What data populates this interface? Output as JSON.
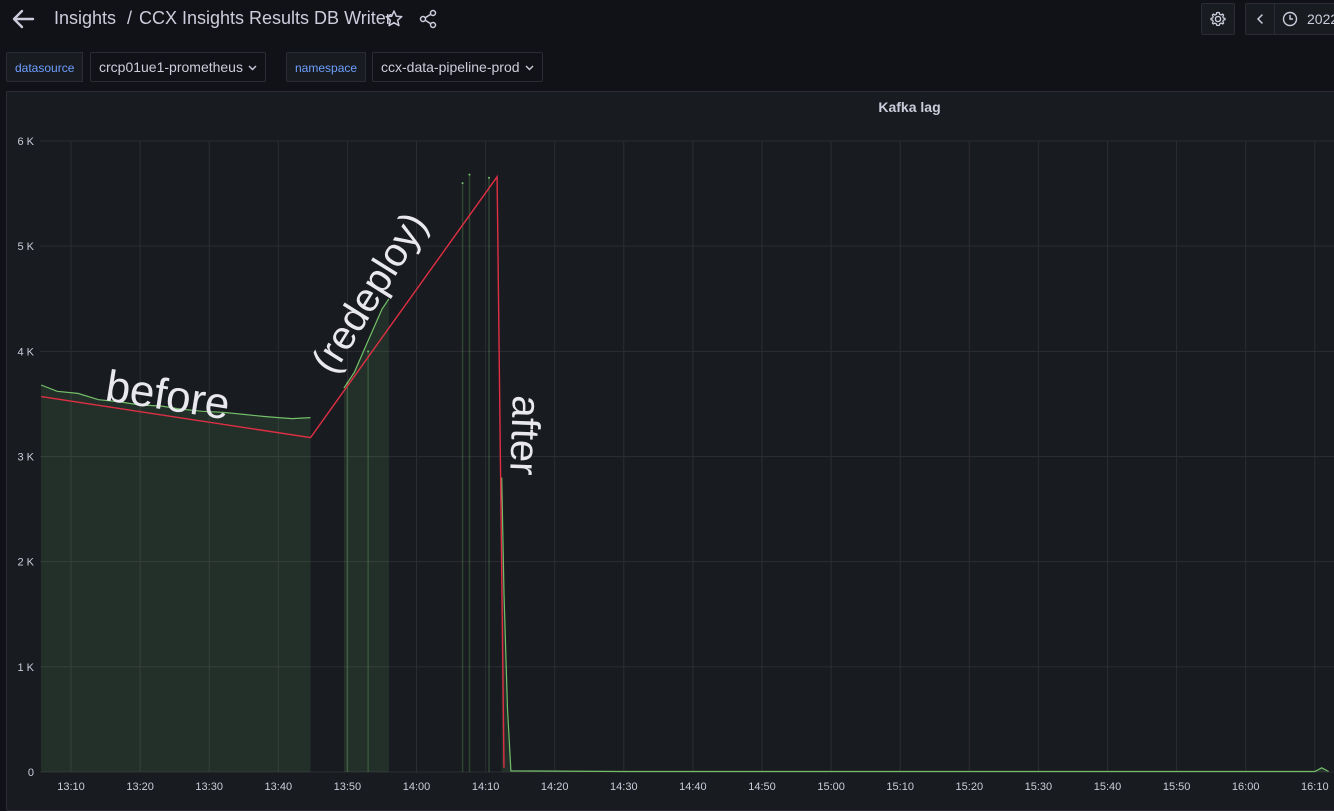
{
  "header": {
    "breadcrumb_parent": "Insights",
    "breadcrumb_separator": "/",
    "title": "CCX Insights Results DB Writer",
    "time_range_text": "2022"
  },
  "icons": {
    "back": "arrow-left-icon",
    "star": "star-icon",
    "share": "share-icon",
    "settings": "gear-icon",
    "prev": "chevron-left-icon",
    "clock": "clock-icon",
    "dropdown": "chevron-down-icon"
  },
  "variables": [
    {
      "label": "datasource",
      "value": "crcp01ue1-prometheus"
    },
    {
      "label": "namespace",
      "value": "ccx-data-pipeline-prod"
    }
  ],
  "panel": {
    "title": "Kafka lag"
  },
  "annotations": {
    "before": "before",
    "redeploy": "(redeploy)",
    "after": "after"
  },
  "colors": {
    "series_line": "#73bf69",
    "annotation_line": "#e02f44",
    "background": "#111217",
    "panel": "#181b1f"
  },
  "chart_data": {
    "type": "area",
    "title": "Kafka lag",
    "x_ticks": [
      "13:10",
      "13:20",
      "13:30",
      "13:40",
      "13:50",
      "14:00",
      "14:10",
      "14:20",
      "14:30",
      "14:40",
      "14:50",
      "15:00",
      "15:10",
      "15:20",
      "15:30",
      "15:40",
      "15:50",
      "16:00",
      "16:10"
    ],
    "y_ticks": [
      "0",
      "1 K",
      "2 K",
      "3 K",
      "4 K",
      "5 K",
      "6 K"
    ],
    "ylim": [
      0,
      6000
    ],
    "grid": true,
    "series": [
      {
        "points": [
          [
            "13:05:40",
            3680
          ],
          [
            "13:08:00",
            3620
          ],
          [
            "13:11:00",
            3600
          ],
          [
            "13:14:00",
            3540
          ],
          [
            "13:17:00",
            3520
          ],
          [
            "13:20:00",
            3490
          ],
          [
            "13:23:00",
            3480
          ],
          [
            "13:26:00",
            3450
          ],
          [
            "13:29:00",
            3430
          ],
          [
            "13:32:00",
            3420
          ],
          [
            "13:35:00",
            3400
          ],
          [
            "13:38:00",
            3380
          ],
          [
            "13:40:00",
            3370
          ],
          [
            "13:42:00",
            3360
          ],
          [
            "13:44:40",
            3370
          ]
        ]
      },
      {
        "points": [
          [
            "13:49:30",
            3650
          ],
          [
            "13:51:00",
            3800
          ],
          [
            "13:53:00",
            4100
          ],
          [
            "13:55:00",
            4400
          ],
          [
            "13:56:00",
            4500
          ]
        ]
      },
      {
        "points": [
          [
            "14:12:20",
            2800
          ],
          [
            "14:12:40",
            1700
          ],
          [
            "14:13:10",
            600
          ],
          [
            "14:13:40",
            10
          ],
          [
            "14:30:00",
            5
          ],
          [
            "15:00:00",
            5
          ],
          [
            "15:30:00",
            5
          ],
          [
            "16:00:00",
            5
          ],
          [
            "16:10:00",
            5
          ],
          [
            "16:11:00",
            40
          ],
          [
            "16:12:00",
            5
          ]
        ]
      }
    ],
    "spikes": [
      {
        "x": "13:50:00",
        "y": 3700
      },
      {
        "x": "13:53:00",
        "y": 4000
      },
      {
        "x": "14:06:40",
        "y": 5600
      },
      {
        "x": "14:07:40",
        "y": 5680
      },
      {
        "x": "14:10:30",
        "y": 5650
      }
    ],
    "drawn_annotation_line": [
      [
        "13:05:40",
        3570
      ],
      [
        "13:44:40",
        3180
      ],
      [
        "14:11:40",
        5660
      ],
      [
        "14:12:40",
        40
      ]
    ]
  }
}
